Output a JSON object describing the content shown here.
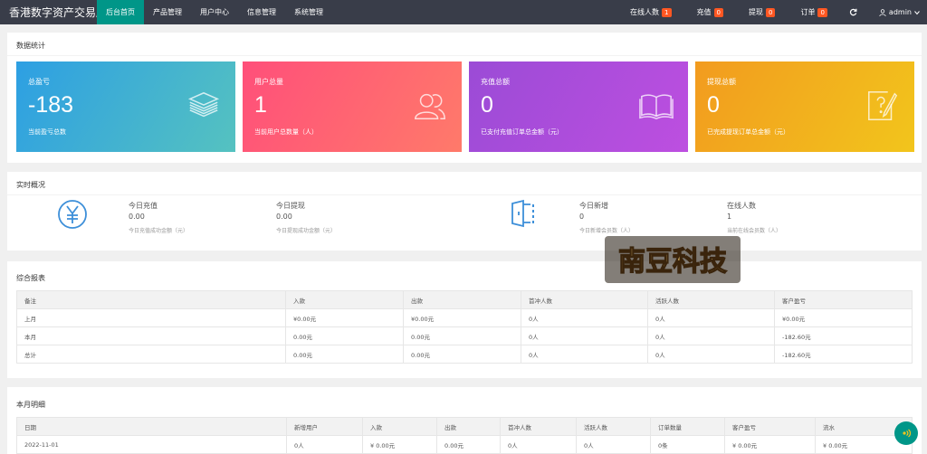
{
  "header": {
    "brand": "香港数字资产交易所",
    "nav": [
      "后台首页",
      "产品管理",
      "用户中心",
      "信息管理",
      "系统管理"
    ],
    "online_label": "在线人数",
    "online_count": "1",
    "recharge_label": "充值",
    "recharge_count": "0",
    "withdraw_label": "提现",
    "withdraw_count": "0",
    "order_label": "订单",
    "order_count": "0",
    "user": "admin"
  },
  "stats": {
    "title": "数据统计",
    "cards": [
      {
        "label": "总盈亏",
        "value": "-183",
        "sub": "当前盈亏总数",
        "icon": "layers-icon",
        "color": "#2f9fe0"
      },
      {
        "label": "用户总量",
        "value": "1",
        "sub": "当前用户总数量（人）",
        "icon": "users-icon",
        "color": "#ff5a78"
      },
      {
        "label": "充值总额",
        "value": "0",
        "sub": "已支付充值订单总金额（元）",
        "icon": "book-icon",
        "color": "#a849dc"
      },
      {
        "label": "提现总额",
        "value": "0",
        "sub": "已完成提现订单总金额（元）",
        "icon": "edit-icon",
        "color": "#f3a51f"
      }
    ]
  },
  "realtime": {
    "title": "实时概况",
    "today_recharge_label": "今日充值",
    "today_recharge_value": "0.00",
    "today_recharge_sub": "今日充值成功金额（元）",
    "today_withdraw_label": "今日提现",
    "today_withdraw_value": "0.00",
    "today_withdraw_sub": "今日提现成功金额（元）",
    "today_new_label": "今日新增",
    "today_new_value": "0",
    "today_new_sub": "今日新增会员数（人）",
    "online_label": "在线人数",
    "online_value": "1",
    "online_sub": "当前在线会员数（人）"
  },
  "report": {
    "title": "综合报表",
    "columns": [
      "备注",
      "入款",
      "出款",
      "首冲人数",
      "活跃人数",
      "客户盈亏"
    ],
    "rows": [
      [
        "上月",
        "¥0.00元",
        "¥0.00元",
        "0人",
        "0人",
        "¥0.00元"
      ],
      [
        "本月",
        "0.00元",
        "0.00元",
        "0人",
        "0人",
        "-182.60元"
      ],
      [
        "总计",
        "0.00元",
        "0.00元",
        "0人",
        "0人",
        "-182.60元"
      ]
    ]
  },
  "monthly": {
    "title": "本月明细",
    "columns": [
      "日期",
      "新增用户",
      "入款",
      "出款",
      "首冲人数",
      "活跃人数",
      "订单数量",
      "客户盈亏",
      "流水"
    ],
    "rows": [
      [
        "2022-11-01",
        "0人",
        "¥ 0.00元",
        "0.00元",
        "0人",
        "0人",
        "0条",
        "¥ 0.00元",
        "¥ 0.00元"
      ]
    ]
  },
  "watermark": "南豆科技"
}
